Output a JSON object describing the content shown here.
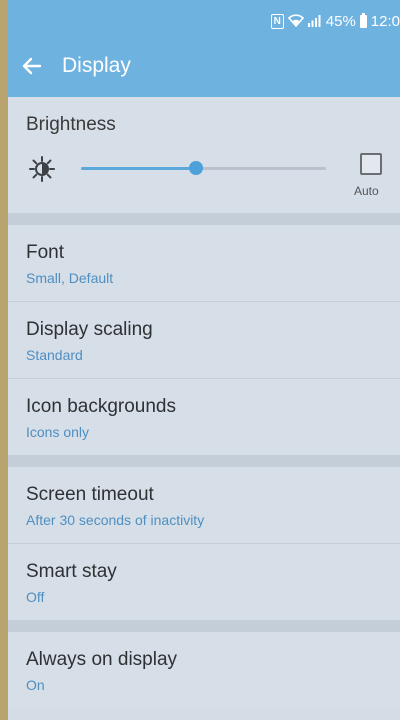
{
  "status_bar": {
    "battery_percent": "45%",
    "time": "12:0"
  },
  "toolbar": {
    "title": "Display"
  },
  "brightness": {
    "title": "Brightness",
    "level": 0.47,
    "auto_label": "Auto",
    "auto_checked": false
  },
  "settings": [
    {
      "title": "Font",
      "subtitle": "Small, Default"
    },
    {
      "title": "Display scaling",
      "subtitle": "Standard"
    },
    {
      "title": "Icon backgrounds",
      "subtitle": "Icons only"
    },
    {
      "title": "Screen timeout",
      "subtitle": "After 30 seconds of inactivity"
    },
    {
      "title": "Smart stay",
      "subtitle": "Off"
    },
    {
      "title": "Always on display",
      "subtitle": "On"
    }
  ],
  "colors": {
    "app_bar": "#6eb2e0",
    "accent": "#4da0da",
    "subtitle": "#4f8fc1"
  },
  "icons": {
    "back": "arrow-back-icon",
    "brightness": "sun-icon",
    "nfc": "nfc-icon",
    "wifi": "wifi-icon",
    "signal": "signal-icon",
    "battery": "battery-icon"
  }
}
